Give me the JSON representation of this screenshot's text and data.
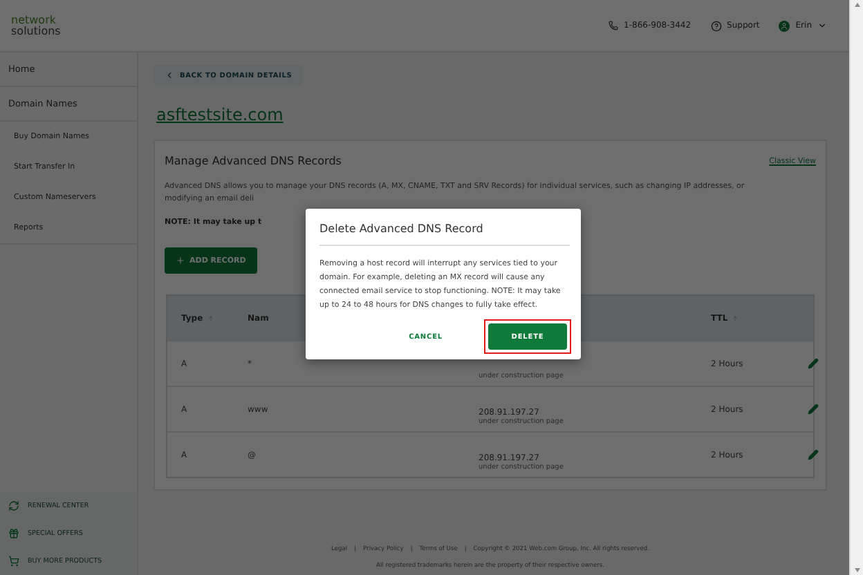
{
  "header": {
    "logo_lines": [
      "network",
      "solutions"
    ],
    "phone": "1-866-908-3442",
    "support": "Support",
    "user": "Erin"
  },
  "sidebar": {
    "items": [
      {
        "label": "Home",
        "kind": "section"
      },
      {
        "label": "Domain Names",
        "kind": "section"
      },
      {
        "label": "Buy Domain Names",
        "kind": "link"
      },
      {
        "label": "Start Transfer In",
        "kind": "link"
      },
      {
        "label": "Custom Nameservers",
        "kind": "link"
      },
      {
        "label": "Reports",
        "kind": "link"
      }
    ],
    "bottom_items": [
      "RENEWAL CENTER",
      "SPECIAL OFFERS",
      "BUY MORE PRODUCTS"
    ]
  },
  "back_button": "BACK TO DOMAIN DETAILS",
  "domain": "asftestsite.com",
  "card": {
    "title": "Manage Advanced DNS Records",
    "link": "Classic View",
    "description_lines": [
      "Advanced DNS allows you to manage your DNS records (A, MX, CNAME, TXT and SRV Records) for individual services, such as changing IP addresses, or",
      "modifying an email deli"
    ],
    "note": "NOTE: It may take up t",
    "add_button": "ADD RECORD",
    "table": {
      "columns": [
        "Type",
        "Nam",
        "TTL"
      ],
      "rows": [
        {
          "type": "A",
          "name": "*",
          "value": "",
          "value_note": "under construction page",
          "ttl": "2 Hours"
        },
        {
          "type": "A",
          "name": "www",
          "value": "208.91.197.27",
          "value_note": "under construction page",
          "ttl": "2 Hours"
        },
        {
          "type": "A",
          "name": "@",
          "value": "208.91.197.27",
          "value_note": "under construction page",
          "ttl": "2 Hours"
        }
      ]
    }
  },
  "footer": {
    "separators": [
      "|",
      "|",
      "|"
    ],
    "links": [
      "Legal",
      "Privacy Policy",
      "Terms of Use",
      "Copyright © 2021 Web.com Group, Inc. All rights reserved."
    ],
    "note": "All registered trademarks herein are the property of their respective owners."
  },
  "dialog": {
    "title": "Delete Advanced DNS Record",
    "body": "Removing a host record will interrupt any services tied to your domain. For example, deleting an MX record will cause any connected email service to stop functioning. NOTE: It may take up to 24 to 48 hours for DNS changes to fully take effect.",
    "cancel": "CANCEL",
    "confirm": "DELETE",
    "confirm_highlighted": true
  }
}
